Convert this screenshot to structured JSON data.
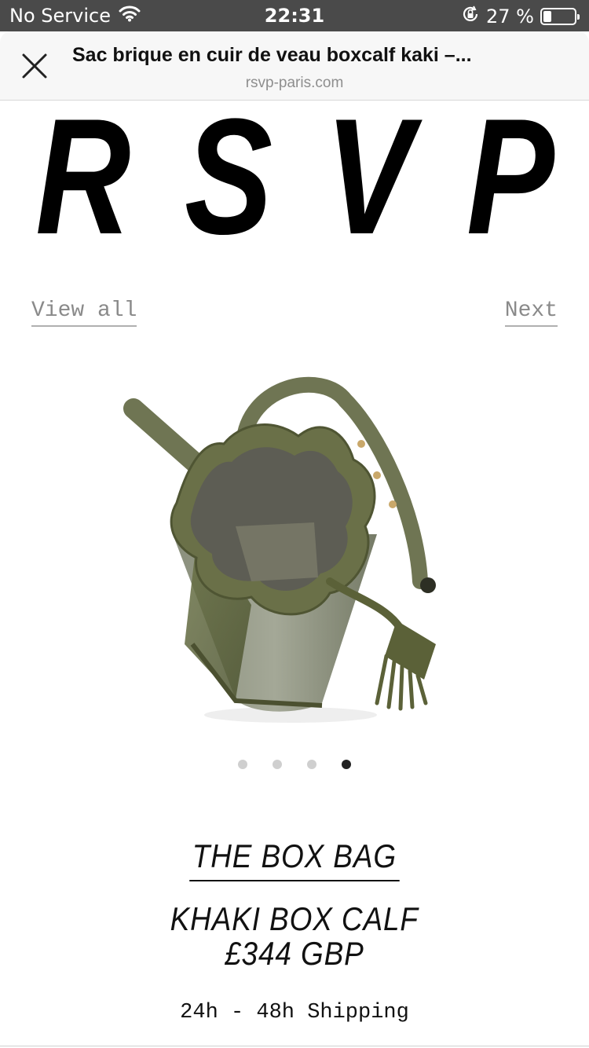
{
  "status_bar": {
    "carrier": "No Service",
    "time": "22:31",
    "battery_percent": "27 %",
    "battery_level": 0.27,
    "icons": [
      "wifi-icon",
      "orientation-lock-icon",
      "battery-icon"
    ]
  },
  "browser": {
    "page_title": "Sac brique en cuir de veau boxcalf kaki –...",
    "domain": "rsvp-paris.com",
    "close_icon": "close-icon"
  },
  "logo": {
    "letters": [
      "R",
      "S",
      "V",
      "P"
    ]
  },
  "nav": {
    "view_all": "View all",
    "next": "Next"
  },
  "gallery": {
    "image_name": "khaki-bucket-bag-image",
    "dot_count": 4,
    "active_index": 3
  },
  "product": {
    "name": "THE BOX BAG",
    "variant": "KHAKI BOX CALF",
    "price": "£344 GBP",
    "shipping": "24h - 48h Shipping"
  },
  "colors": {
    "status_bar_bg": "#4a4a4a",
    "header_bg": "#f7f7f7",
    "link_gray": "#8a8a8a",
    "bag_khaki": "#565d3a"
  }
}
